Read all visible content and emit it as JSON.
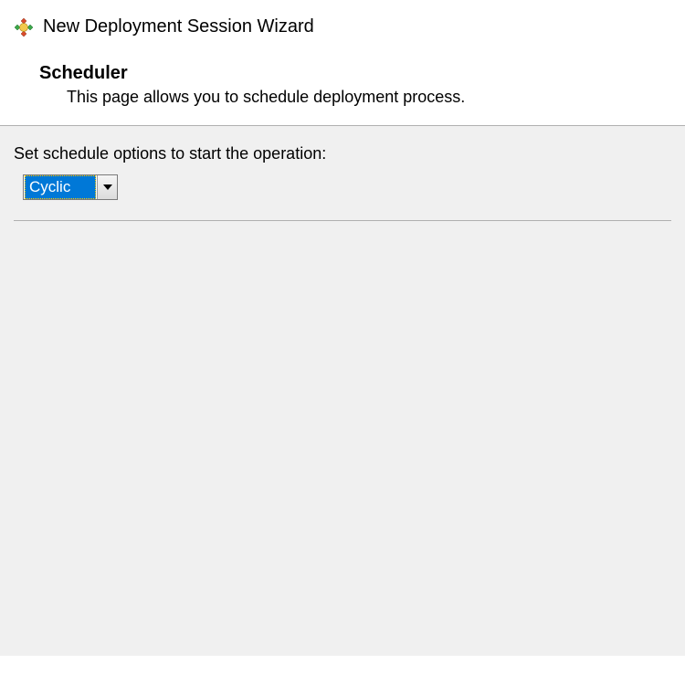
{
  "header": {
    "wizard_title": "New Deployment Session Wizard",
    "page_heading": "Scheduler",
    "page_description": "This page allows you to schedule deployment process."
  },
  "body": {
    "schedule_label": "Set schedule options to start the operation:",
    "schedule_dropdown": {
      "selected": "Cyclic"
    }
  },
  "icons": {
    "wizard": "deployment-wizard-icon"
  }
}
